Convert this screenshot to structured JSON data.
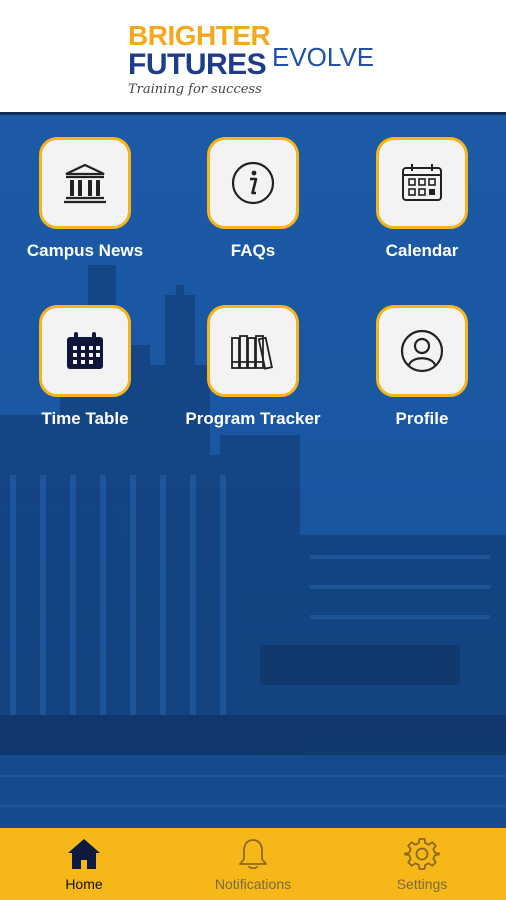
{
  "header": {
    "logo_line1": "BRIGHTER",
    "logo_line2": "FUTURES",
    "logo_tagline": "Training for success",
    "app_name": "EVOLVE"
  },
  "tiles": [
    {
      "label": "Campus News",
      "icon": "bank-icon"
    },
    {
      "label": "FAQs",
      "icon": "info-icon"
    },
    {
      "label": "Calendar",
      "icon": "calendar-icon"
    },
    {
      "label": "Time Table",
      "icon": "timetable-icon"
    },
    {
      "label": "Program Tracker",
      "icon": "books-icon"
    },
    {
      "label": "Profile",
      "icon": "user-icon"
    }
  ],
  "tabbar": {
    "items": [
      {
        "label": "Home",
        "icon": "home-icon",
        "active": true
      },
      {
        "label": "Notifications",
        "icon": "bell-icon",
        "active": false
      },
      {
        "label": "Settings",
        "icon": "gear-icon",
        "active": false
      }
    ]
  },
  "colors": {
    "accent": "#f6b818",
    "background_blue": "#18539c",
    "brand_navy": "#1e3c8c",
    "brand_orange": "#f4a81d"
  }
}
